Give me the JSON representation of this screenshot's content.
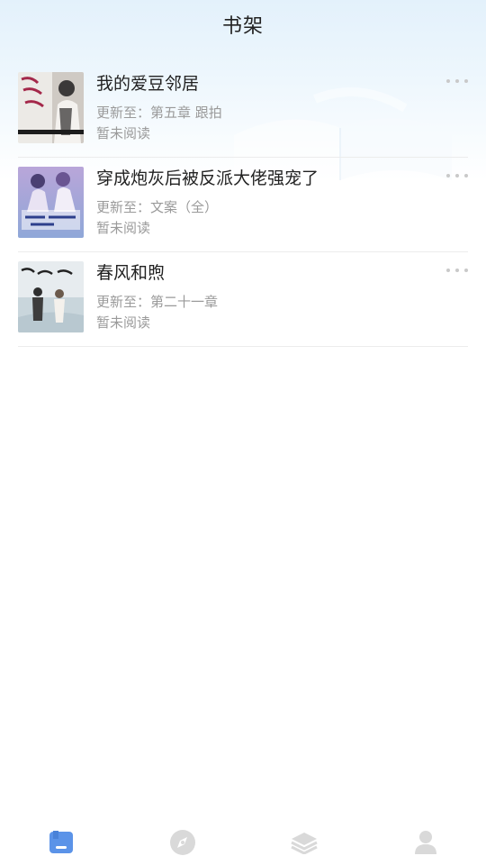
{
  "header": {
    "title": "书架"
  },
  "colors": {
    "accent": "#5b93e8",
    "inactive": "#d6d6d6",
    "muted": "#9a9a9a"
  },
  "books": [
    {
      "title": "我的爱豆邻居",
      "update": "更新至：第五章 跟拍",
      "status": "暂未阅读"
    },
    {
      "title": "穿成炮灰后被反派大佬强宠了",
      "update": "更新至：文案（全）",
      "status": "暂未阅读"
    },
    {
      "title": "春风和煦",
      "update": "更新至：第二十一章",
      "status": "暂未阅读"
    }
  ],
  "tabs": [
    {
      "name": "bookshelf",
      "icon": "bookshelf-icon",
      "active": true
    },
    {
      "name": "discover",
      "icon": "compass-icon",
      "active": false
    },
    {
      "name": "category",
      "icon": "layers-icon",
      "active": false
    },
    {
      "name": "profile",
      "icon": "user-icon",
      "active": false
    }
  ]
}
